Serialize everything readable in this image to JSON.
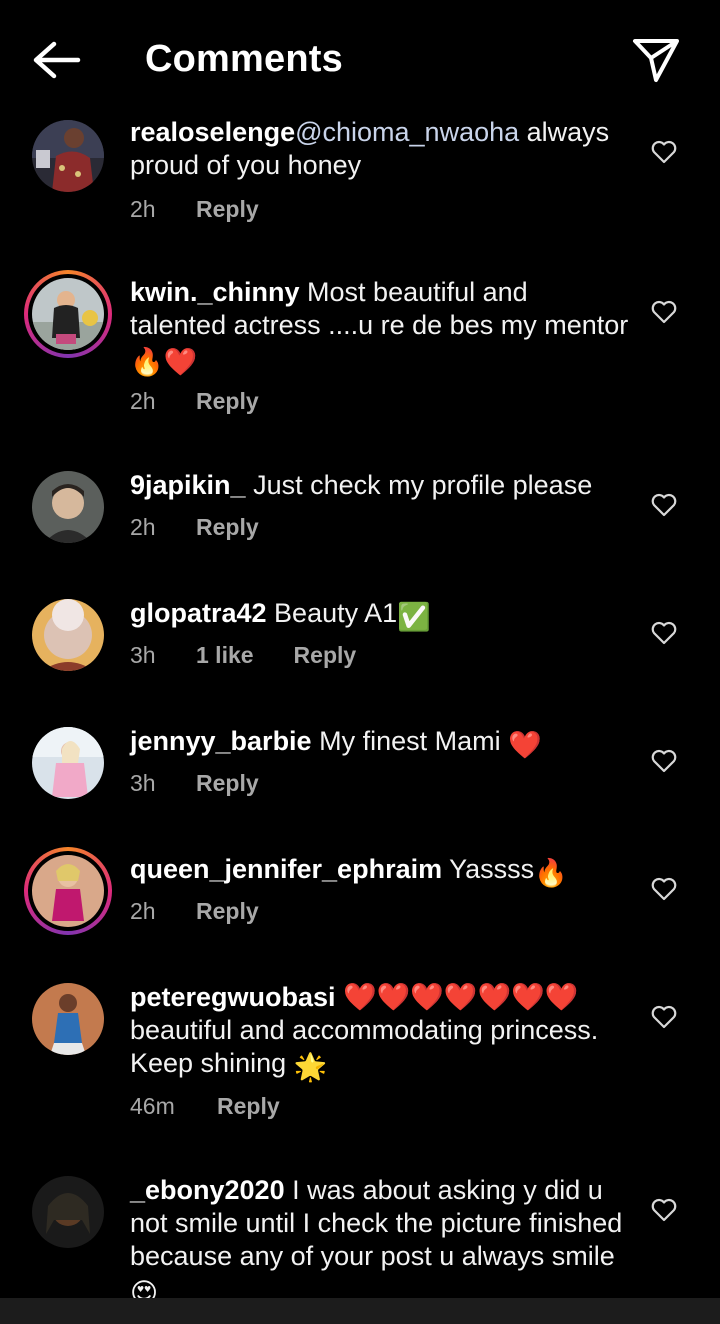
{
  "header": {
    "title": "Comments"
  },
  "comments": [
    {
      "username": "realoselenge",
      "mention": "@chioma_nwaoha",
      "text": " always proud of you honey",
      "time": "2h",
      "likes": "",
      "reply": "Reply"
    },
    {
      "username": "kwin._chinny",
      "mention": "",
      "text": " Most beautiful and talented actress ....u re de bes my mentor",
      "emojis": "🔥❤️",
      "time": "2h",
      "likes": "",
      "reply": "Reply"
    },
    {
      "username": "9japikin_",
      "mention": "",
      "text": " Just check my profile please",
      "time": "2h",
      "likes": "",
      "reply": "Reply"
    },
    {
      "username": "glopatra42",
      "mention": "",
      "text": " Beauty A1",
      "emojis": "✅",
      "time": "3h",
      "likes": "1 like",
      "reply": "Reply"
    },
    {
      "username": "jennyy_barbie",
      "mention": "",
      "text": " My finest Mami ",
      "emojis": "❤️",
      "time": "3h",
      "likes": "",
      "reply": "Reply"
    },
    {
      "username": "queen_jennifer_ephraim",
      "mention": "",
      "text": " Yassss",
      "emojis": "🔥",
      "time": "2h",
      "likes": "",
      "reply": "Reply"
    },
    {
      "username": "peteregwuobasi",
      "mention": "",
      "text": " ❤️❤️❤️❤️❤️❤️❤️ beautiful and accommodating princess. Keep shining ",
      "emojis": "🌟",
      "time": "46m",
      "likes": "",
      "reply": "Reply"
    },
    {
      "username": "_ebony2020",
      "mention": "",
      "text": " I was about asking y did u not smile until I check the picture finished because any of your post u always smile ",
      "emojis": "😍",
      "time": "",
      "likes": "",
      "reply": ""
    }
  ]
}
